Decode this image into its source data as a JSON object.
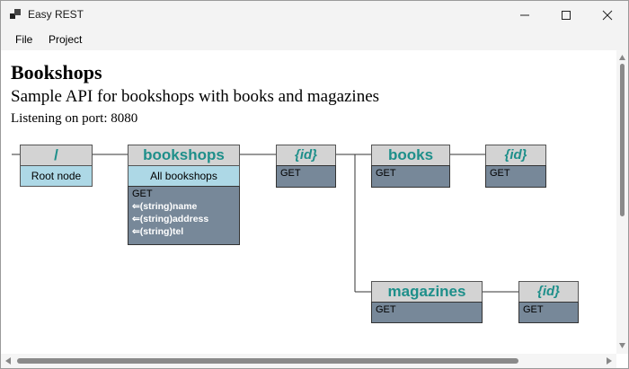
{
  "window": {
    "title": "Easy REST"
  },
  "menu": {
    "file": "File",
    "project": "Project"
  },
  "api": {
    "name": "Bookshops",
    "description": "Sample API for bookshops with books and magazines",
    "port_text": "Listening on port: 8080"
  },
  "nodes": {
    "root": {
      "label": "/",
      "description": "Root node"
    },
    "bookshops": {
      "label": "bookshops",
      "description": "All bookshops",
      "method": "GET",
      "params": [
        "⇐(string)name",
        "⇐(string)address",
        "⇐(string)tel"
      ]
    },
    "bookshop_id": {
      "label": "{id}",
      "method": "GET"
    },
    "books": {
      "label": "books",
      "method": "GET"
    },
    "book_id": {
      "label": "{id}",
      "method": "GET"
    },
    "magazines": {
      "label": "magazines",
      "method": "GET"
    },
    "magazine_id": {
      "label": "{id}",
      "method": "GET"
    }
  },
  "colors": {
    "node_header": "#d3d3d3",
    "node_label": "#1e8f8a",
    "node_description": "#add8e6",
    "node_method": "#778899"
  }
}
